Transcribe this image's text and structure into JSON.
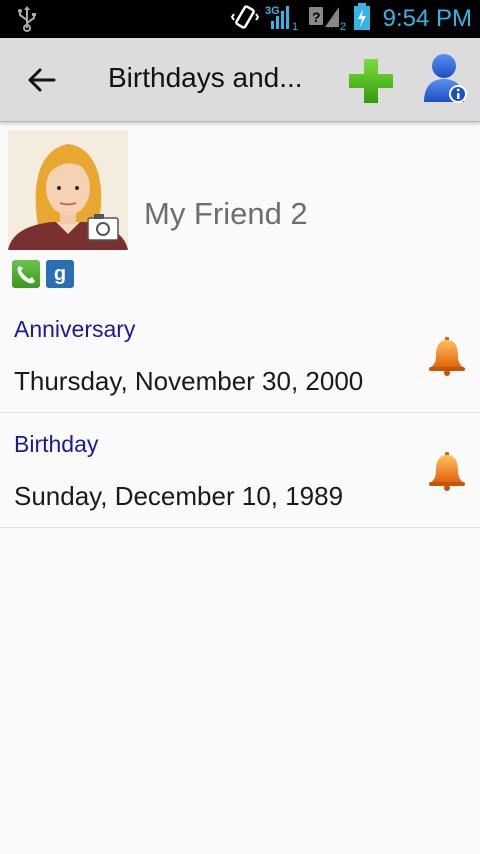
{
  "status_bar": {
    "time": "9:54 PM",
    "network": "3G",
    "sim1": "1",
    "sim2": "2",
    "accent_color": "#33b5e5"
  },
  "action_bar": {
    "title": "Birthdays and...",
    "icons": [
      "back-arrow-icon",
      "add-icon",
      "contact-info-icon"
    ]
  },
  "contact": {
    "name": "My Friend 2",
    "accounts": [
      "phone-account-icon",
      "google-account-icon"
    ],
    "google_letter": "g"
  },
  "events": [
    {
      "label": "Anniversary",
      "date": "Thursday, November 30, 2000"
    },
    {
      "label": "Birthday",
      "date": "Sunday, December 10, 1989"
    }
  ],
  "colors": {
    "event_label": "#1a1a9a",
    "add_green": "#4ec41a",
    "bell_orange": "#f08a1c"
  }
}
